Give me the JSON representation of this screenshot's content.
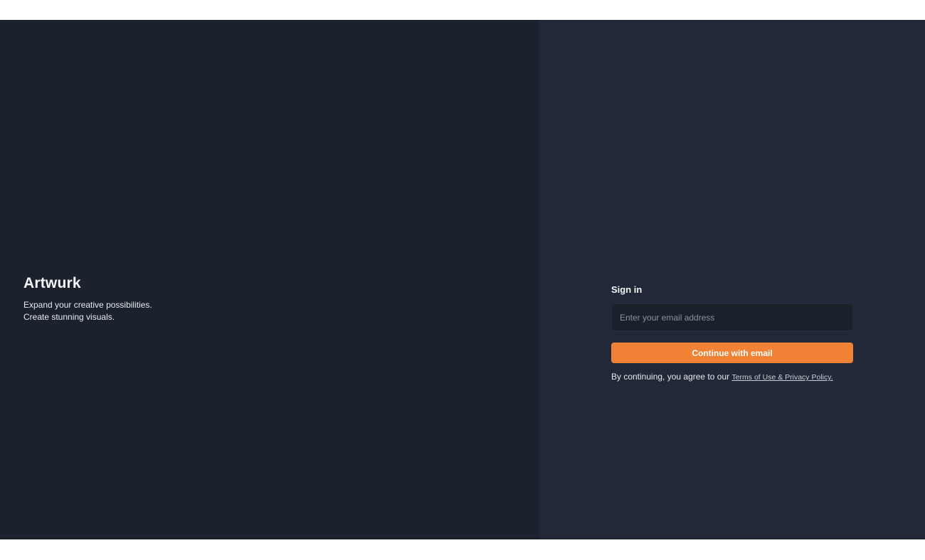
{
  "brand": {
    "title": "Artwurk",
    "tagline_line1": "Expand your creative possibilities.",
    "tagline_line2": "Create stunning visuals."
  },
  "signin": {
    "heading": "Sign in",
    "email_placeholder": "Enter your email address",
    "email_value": "",
    "continue_label": "Continue with email",
    "legal_prefix": "By continuing, you agree to our ",
    "legal_link": "Terms of Use & Privacy Policy."
  },
  "colors": {
    "left_bg": "#1b222d",
    "right_bg": "#212938",
    "input_bg": "#1a212b",
    "accent": "#f08135"
  }
}
